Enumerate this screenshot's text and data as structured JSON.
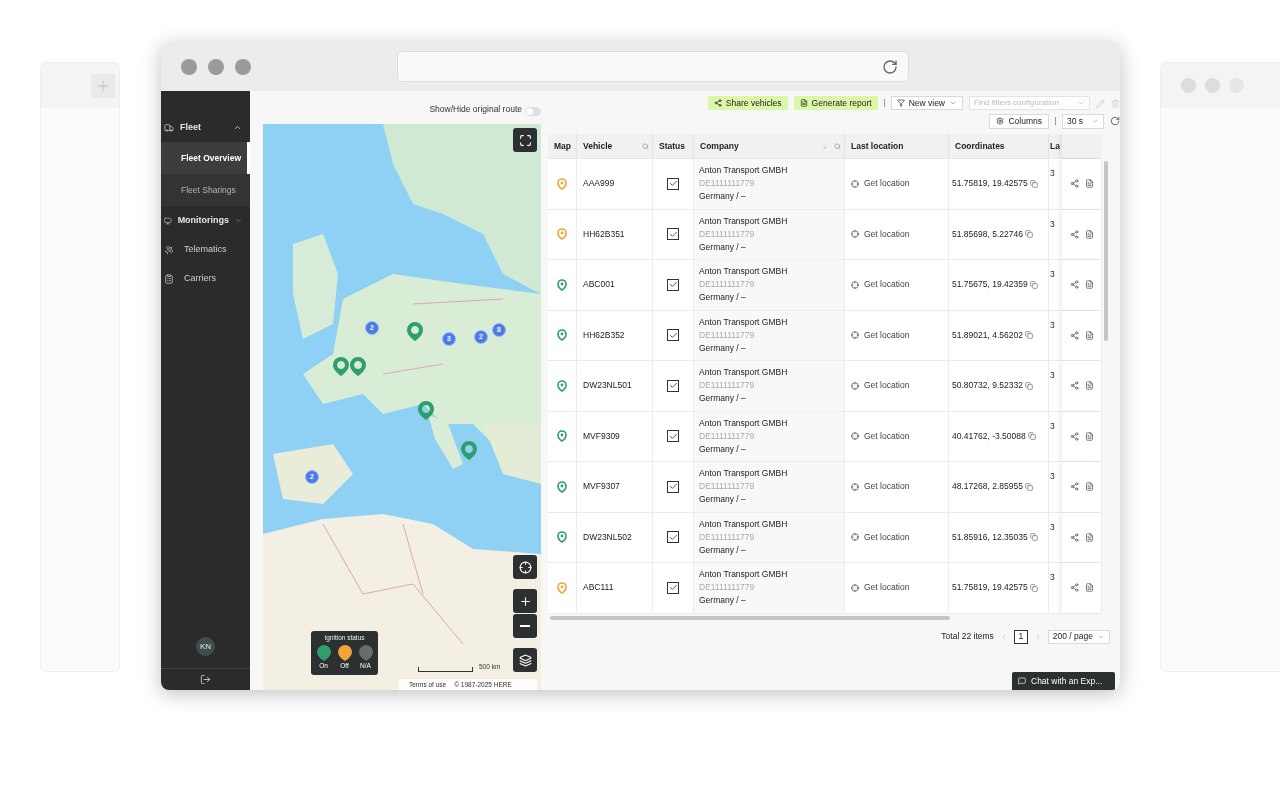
{
  "sidebar": {
    "items": [
      {
        "kind": "group",
        "label": "Fleet",
        "expanded": true,
        "children": [
          {
            "label": "Fleet Overview",
            "selected": true
          },
          {
            "label": "Fleet Sharings",
            "selected": false
          }
        ]
      },
      {
        "kind": "group",
        "label": "Monitorings",
        "expanded": false
      },
      {
        "kind": "link",
        "label": "Telematics"
      },
      {
        "kind": "link",
        "label": "Carriers"
      }
    ],
    "avatar": "KN"
  },
  "map": {
    "toggle": {
      "label": "Show/Hide original route",
      "on": false
    },
    "clusters": [
      "2",
      "3",
      "2",
      "8",
      "2"
    ],
    "legend": {
      "title": "Ignition status",
      "items": [
        {
          "label": "On",
          "color": "#2e9e6b"
        },
        {
          "label": "Off",
          "color": "#f0a53a"
        },
        {
          "label": "N/A",
          "color": "#6b6b6b"
        }
      ]
    },
    "scale": "500 km",
    "terms": "Terms of use",
    "copyright": "© 1987-2025 HERE"
  },
  "toolbar": {
    "buttons": [
      "Share vehicles",
      "Generate report"
    ],
    "view_select": "New view",
    "filter_placeholder": "Find filters configuration",
    "columns_button": "Columns",
    "refresh_select": "30 s"
  },
  "table": {
    "columns": [
      {
        "label": "Map",
        "searchable": false,
        "sortable": false
      },
      {
        "label": "Vehicle",
        "searchable": true,
        "sortable": false
      },
      {
        "label": "Status",
        "searchable": false,
        "sortable": false
      },
      {
        "label": "Company",
        "searchable": true,
        "sortable": true
      },
      {
        "label": "Last location",
        "searchable": false,
        "sortable": false
      },
      {
        "label": "Coordinates",
        "searchable": false,
        "sortable": false
      },
      {
        "label": "La",
        "searchable": false,
        "sortable": false
      }
    ],
    "rows": [
      {
        "color": "#f0a53a",
        "vehicle": "AAA999",
        "checked": true,
        "company": "Anton Transport GMBH",
        "tax_id": "DE1111111779",
        "country": "Germany / –",
        "location": "Get location",
        "coordinates": "51.75819, 19.42575",
        "column_7": "3"
      },
      {
        "color": "#f0a53a",
        "vehicle": "HH62B351",
        "checked": true,
        "company": "Anton Transport GMBH",
        "tax_id": "DE1111111779",
        "country": "Germany / –",
        "location": "Get location",
        "coordinates": "51.85698, 5.22746",
        "column_7": "3"
      },
      {
        "color": "#2e9e6b",
        "vehicle": "ABC001",
        "checked": true,
        "company": "Anton Transport GMBH",
        "tax_id": "DE1111111779",
        "country": "Germany / –",
        "location": "Get location",
        "coordinates": "51.75675, 19.42359",
        "column_7": "3"
      },
      {
        "color": "#2e9e6b",
        "vehicle": "HH62B352",
        "checked": true,
        "company": "Anton Transport GMBH",
        "tax_id": "DE1111111779",
        "country": "Germany / –",
        "location": "Get location",
        "coordinates": "51.89021, 4.56202",
        "column_7": "3"
      },
      {
        "color": "#2e9e6b",
        "vehicle": "DW23NL501",
        "checked": true,
        "company": "Anton Transport GMBH",
        "tax_id": "DE1111111779",
        "country": "Germany / –",
        "location": "Get location",
        "coordinates": "50.80732, 9.52332",
        "column_7": "3"
      },
      {
        "color": "#2e9e6b",
        "vehicle": "MVF9309",
        "checked": true,
        "company": "Anton Transport GMBH",
        "tax_id": "DE1111111779",
        "country": "Germany / –",
        "location": "Get location",
        "coordinates": "40.41762, -3.50088",
        "column_7": "3"
      },
      {
        "color": "#2e9e6b",
        "vehicle": "MVF9307",
        "checked": true,
        "company": "Anton Transport GMBH",
        "tax_id": "DE1111111779",
        "country": "Germany / –",
        "location": "Get location",
        "coordinates": "48.17268, 2.85955",
        "column_7": "3"
      },
      {
        "color": "#2e9e6b",
        "vehicle": "DW23NL502",
        "checked": true,
        "company": "Anton Transport GMBH",
        "tax_id": "DE1111111779",
        "country": "Germany / –",
        "location": "Get location",
        "coordinates": "51.85916, 12.35035",
        "column_7": "3"
      },
      {
        "color": "#f0a53a",
        "vehicle": "ABC111",
        "checked": true,
        "company": "Anton Transport GMBH",
        "tax_id": "DE1111111779",
        "country": "Germany / –",
        "location": "Get location",
        "coordinates": "51.75819, 19.42575",
        "column_7": "3"
      }
    ]
  },
  "pagination": {
    "total": "Total 22 items",
    "page": "1",
    "page_size": "200 / page"
  },
  "chat_button": "Chat with an Exp..."
}
